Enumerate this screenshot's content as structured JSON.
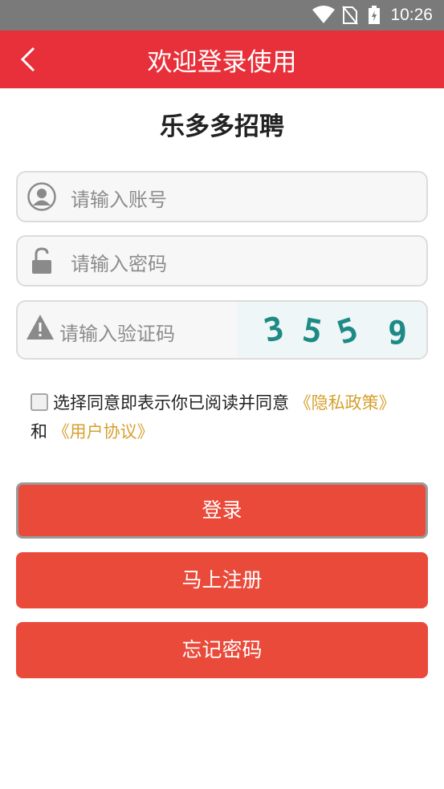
{
  "status_bar": {
    "time": "10:26"
  },
  "header": {
    "title": "欢迎登录使用"
  },
  "app_title": "乐多多招聘",
  "form": {
    "account_placeholder": "请输入账号",
    "password_placeholder": "请输入密码",
    "captcha_placeholder": "请输入验证码",
    "captcha_chars": [
      "3",
      "5",
      "5",
      "9"
    ]
  },
  "agreement": {
    "text": "选择同意即表示你已阅读并同意",
    "privacy_link": "《隐私政策》",
    "and": "和",
    "user_link": "《用户协议》"
  },
  "buttons": {
    "login": "登录",
    "register": "马上注册",
    "forgot": "忘记密码"
  },
  "colors": {
    "header": "#e8303a",
    "button": "#ea4a3a",
    "link": "#d6a02e"
  }
}
